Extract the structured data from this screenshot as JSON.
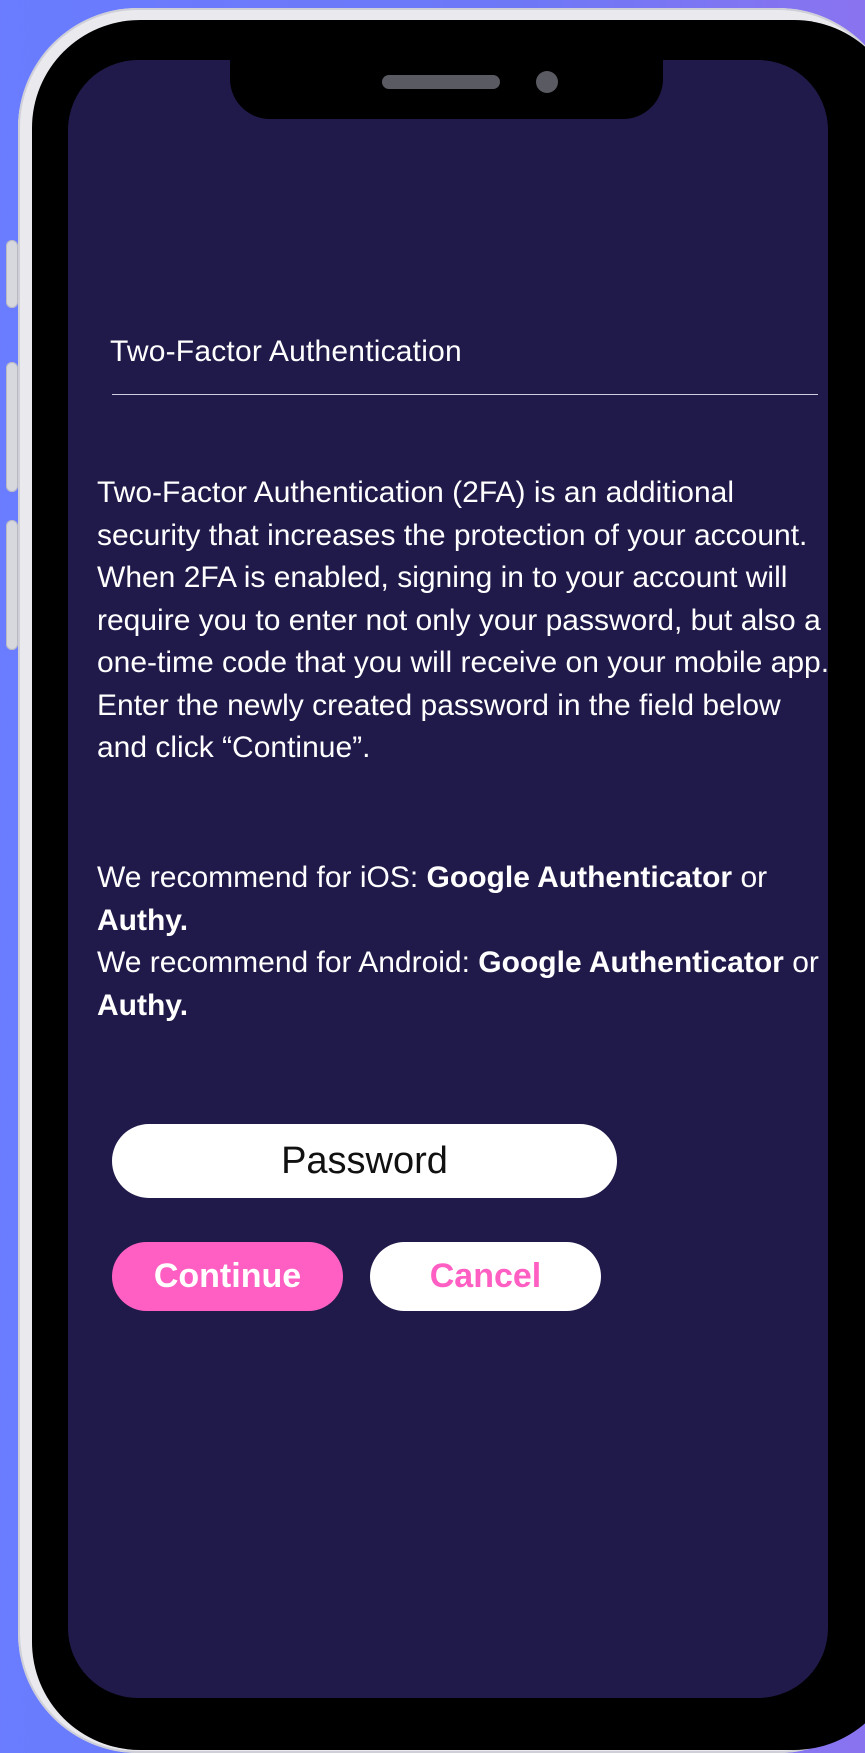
{
  "header": {
    "title": "Two-Factor Authentication"
  },
  "content": {
    "description": "Two-Factor Authentication (2FA) is an additional security that increases the protection of your account. When 2FA is enabled, signing in to your account will require you to enter not only your password, but also a one-time code that you will receive on your mobile app. Enter the newly created password in the field below and click “Continue”.",
    "ios": {
      "prefix": "We recommend for iOS: ",
      "app1": "Google Authenticator",
      "or": " or ",
      "app2": "Authy."
    },
    "android": {
      "prefix": "We recommend for Android: ",
      "app1": "Google Authenticator",
      "or": " or ",
      "app2": "Authy."
    }
  },
  "form": {
    "password_placeholder": "Password",
    "continue_label": "Continue",
    "cancel_label": "Cancel"
  },
  "colors": {
    "screen_background": "#201a4a",
    "accent": "#ff5fc3",
    "text": "#ffffff"
  }
}
